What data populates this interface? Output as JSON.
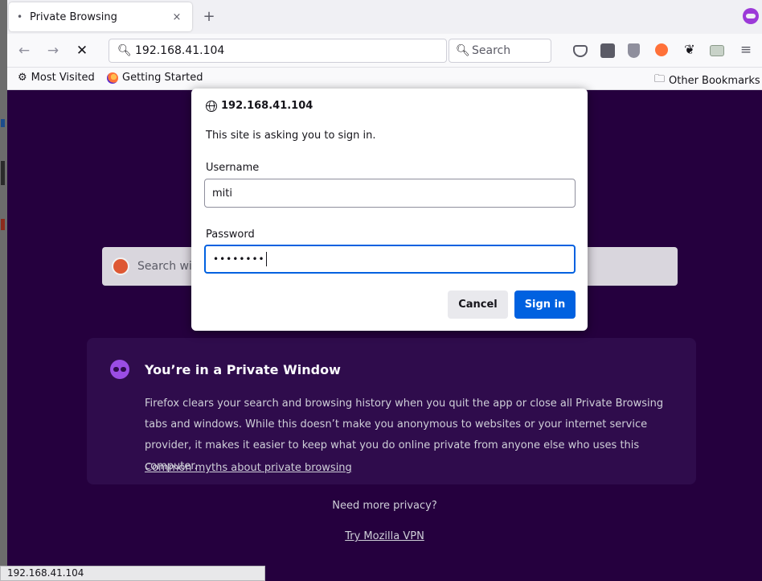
{
  "tab": {
    "title": "Private Browsing",
    "close_glyph": "×",
    "new_tab_glyph": "+"
  },
  "nav": {
    "back_glyph": "←",
    "forward_glyph": "→",
    "stop_glyph": "✕",
    "url": "192.168.41.104",
    "search_placeholder": "Search"
  },
  "bookmarks": {
    "most_visited": "Most Visited",
    "getting_started": "Getting Started",
    "other_bookmarks": "Other Bookmarks"
  },
  "page": {
    "search_placeholder": "Search wi",
    "card_title": "You’re in a Private Window",
    "card_body": "Firefox clears your search and browsing history when you quit the app or close all Private Browsing tabs and windows. While this doesn’t make you anonymous to websites or your internet service provider, it makes it easier to keep what you do online private from anyone else who uses this computer.",
    "card_link": "Common myths about private browsing",
    "privacy_question": "Need more privacy?",
    "vpn_link": "Try Mozilla VPN"
  },
  "dialog": {
    "origin": "192.168.41.104",
    "message": "This site is asking you to sign in.",
    "username_label": "Username",
    "username_value": "miti",
    "password_label": "Password",
    "password_mask": "••••••••",
    "cancel_label": "Cancel",
    "signin_label": "Sign in"
  },
  "status_bar": {
    "text": "192.168.41.104"
  },
  "icons": {
    "pocket": "#e0e0e6",
    "toolbar_colors": [
      "#5b5b66",
      "#8f8f9d",
      "#ff7139",
      "#15141a",
      "#8a9a8a",
      "#5b5b66"
    ]
  }
}
